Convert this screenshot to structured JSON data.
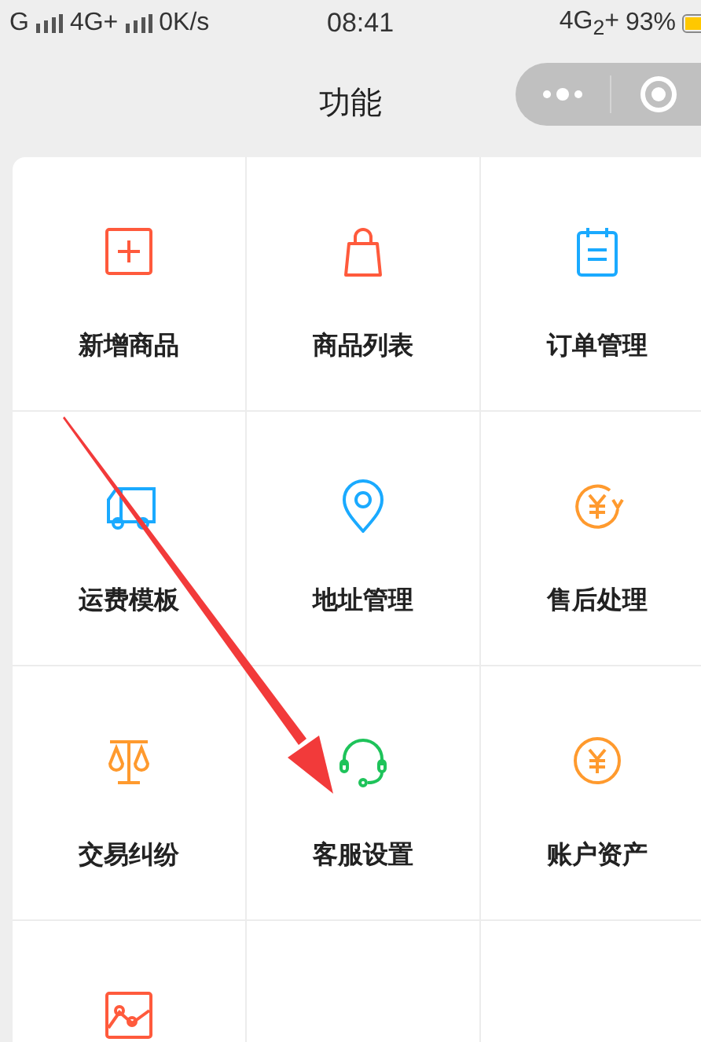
{
  "status_bar": {
    "carrier_1": "G",
    "carrier_2": "4G+",
    "speed": "0K/s",
    "time": "08:41",
    "network": "4G$_{2}$+",
    "battery": "93%"
  },
  "nav": {
    "title": "功能"
  },
  "grid": [
    {
      "label": "新增商品",
      "color": "#ff5a3c"
    },
    {
      "label": "商品列表",
      "color": "#ff5a3c"
    },
    {
      "label": "订单管理",
      "color": "#1aaaff"
    },
    {
      "label": "运费模板",
      "color": "#1aaaff"
    },
    {
      "label": "地址管理",
      "color": "#1aaaff"
    },
    {
      "label": "售后处理",
      "color": "#ff9a2e"
    },
    {
      "label": "交易纠纷",
      "color": "#ff9a2e"
    },
    {
      "label": "客服设置",
      "color": "#1ec35a"
    },
    {
      "label": "账户资产",
      "color": "#ff9a2e"
    },
    {
      "color": "#ff5a3c"
    }
  ]
}
